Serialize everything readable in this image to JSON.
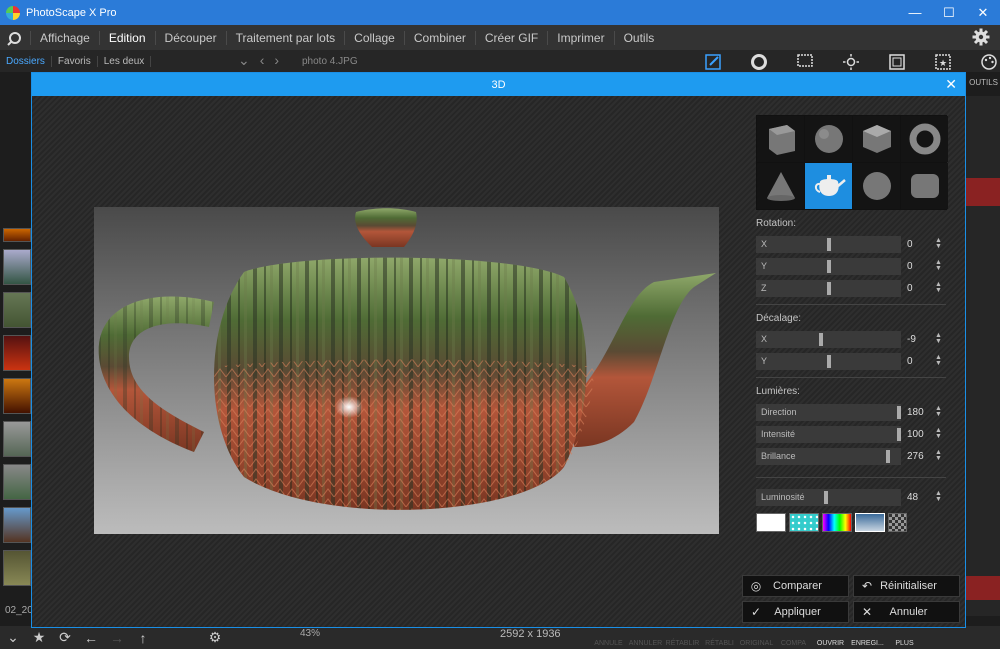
{
  "app": {
    "title": "PhotoScape X Pro",
    "window_controls": [
      "—",
      "☐",
      "✕"
    ]
  },
  "menu": [
    "Affichage",
    "Edition",
    "Découper",
    "Traitement par lots",
    "Collage",
    "Combiner",
    "Créer GIF",
    "Imprimer",
    "Outils"
  ],
  "menu_active": "Edition",
  "subbar": {
    "tabs": [
      "Dossiers",
      "Favoris",
      "Les deux"
    ],
    "file_name": "photo 4.JPG",
    "outils_label": "OUTILS"
  },
  "thumb_label": "02_20",
  "dialog": {
    "title": "3D",
    "rotation_label": "Rotation:",
    "rotation": [
      {
        "name": "X",
        "value": "0",
        "level": 0.5
      },
      {
        "name": "Y",
        "value": "0",
        "level": 0.5
      },
      {
        "name": "Z",
        "value": "0",
        "level": 0.5
      }
    ],
    "offset_label": "Décalage:",
    "offset": [
      {
        "name": "X",
        "value": "-9",
        "level": 0.45
      },
      {
        "name": "Y",
        "value": "0",
        "level": 0.5
      }
    ],
    "lights_label": "Lumières:",
    "lights": [
      {
        "name": "Direction",
        "value": "180",
        "level": 1.0
      },
      {
        "name": "Intensité",
        "value": "100",
        "level": 1.0
      },
      {
        "name": "Brillance",
        "value": "276",
        "level": 0.92
      }
    ],
    "brightness": {
      "name": "Luminosité",
      "value": "48",
      "level": 0.48
    },
    "buttons": {
      "compare": "Comparer",
      "reset": "Réinitialiser",
      "apply": "Appliquer",
      "cancel": "Annuler"
    }
  },
  "bottom": {
    "zoom": "43%",
    "size": "2592 x 1936",
    "actions": [
      "ANNULE",
      "ANNULER",
      "RÉTABLIR",
      "RÉTABLI",
      "ORIGINAL",
      "COMPA",
      "OUVRIR",
      "ENREGI...",
      "PLUS"
    ]
  },
  "colors": {
    "accent": "#1e9bf0",
    "titlebar": "#2b7bd8"
  }
}
